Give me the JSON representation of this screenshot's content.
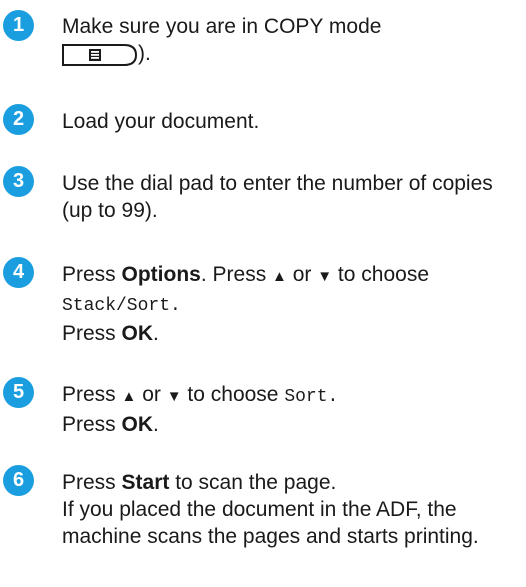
{
  "steps": [
    {
      "number": "1",
      "text": "Make sure you are in COPY mode",
      "tail": ").",
      "icon": "copy-mode-key-icon"
    },
    {
      "number": "2",
      "text": "Load your document."
    },
    {
      "number": "3",
      "text": "Use the dial pad to enter the number of copies (up to 99)."
    },
    {
      "number": "4",
      "press": "Press ",
      "options": "Options",
      "mid": ". Press ",
      "up": "▲",
      "or": " or ",
      "down": "▼",
      "choose": " to choose",
      "value": "Stack/Sort.",
      "press2": "Press ",
      "ok": "OK",
      "dot": "."
    },
    {
      "number": "5",
      "press": "Press ",
      "up": "▲",
      "or": " or ",
      "down": "▼",
      "choose": " to choose ",
      "value": "Sort.",
      "press2": "Press ",
      "ok": "OK",
      "dot": "."
    },
    {
      "number": "6",
      "press": "Press ",
      "start": "Start",
      "rest": " to scan the page.",
      "line2": "If you placed the document in the ADF, the machine scans the pages and starts printing."
    }
  ],
  "colors": {
    "step_badge": "#1a9ee0",
    "text": "#1a1a1a"
  }
}
